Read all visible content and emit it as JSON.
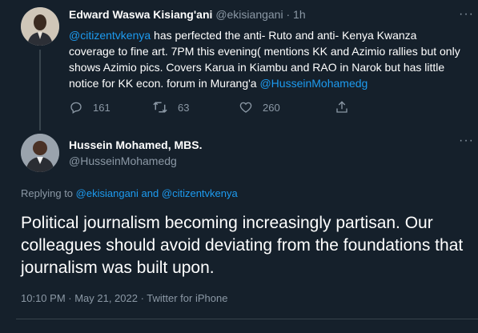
{
  "parent_tweet": {
    "author_name": "Edward Waswa Kisiang'ani",
    "author_handle": "@ekisiangani",
    "time": "1h",
    "text_segments": [
      {
        "text": "@citizentvkenya",
        "type": "mention"
      },
      {
        "text": " has perfected the anti- Ruto and anti- Kenya Kwanza coverage to fine art. 7PM this evening( mentions KK  and Azimio rallies but only shows Azimio pics. Covers Karua in Kiambu and RAO in Narok but has little notice for KK econ. forum in Murang'a ",
        "type": "text"
      },
      {
        "text": "@HusseinMohamedg",
        "type": "mention"
      }
    ],
    "replies": "161",
    "retweets": "63",
    "likes": "260"
  },
  "main_tweet": {
    "author_name": "Hussein Mohamed, MBS.",
    "author_handle": "@HusseinMohamedg",
    "replying_to_prefix": "Replying to",
    "replying_to_1": "@ekisiangani",
    "replying_to_and": "and",
    "replying_to_2": "@citizentvkenya",
    "text": "Political journalism becoming increasingly partisan. Our colleagues should avoid deviating from the foundations that journalism was built upon.",
    "timestamp": "10:10 PM · May 21, 2022 · Twitter for iPhone"
  },
  "more_glyph": "···",
  "colors": {
    "background": "#15202b",
    "accent": "#1d9bf0",
    "muted": "#8b98a5",
    "divider": "#38444d"
  },
  "icons": [
    "reply-icon",
    "retweet-icon",
    "like-icon",
    "share-icon",
    "more-icon"
  ]
}
